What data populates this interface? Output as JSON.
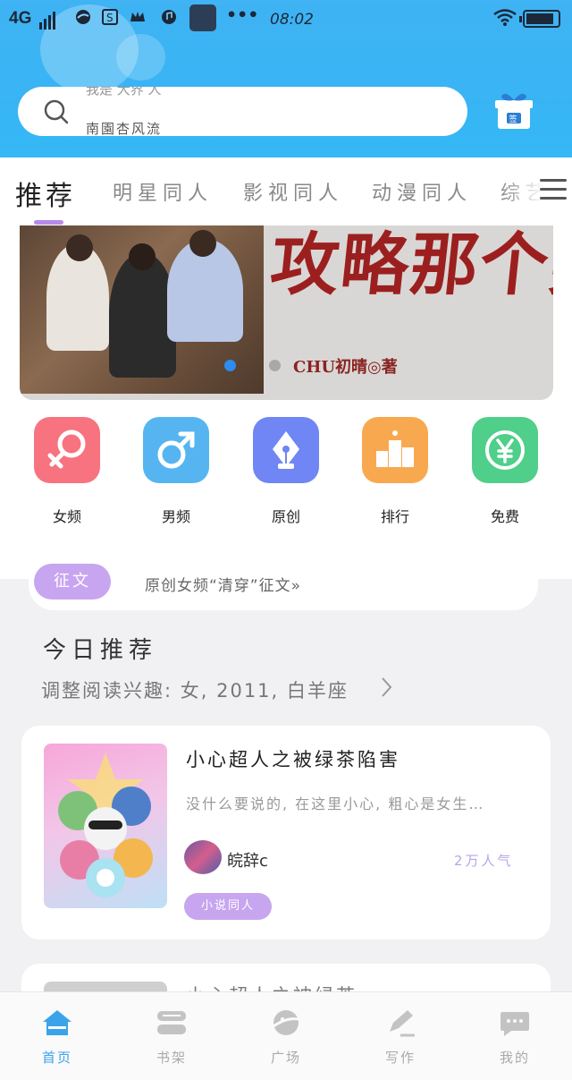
{
  "status_bar": {
    "network": "4G",
    "time": "08:02",
    "dots": "•••"
  },
  "search": {
    "placeholder_scroll_top": "我是 大界 人",
    "placeholder": "南園杏风流"
  },
  "tabs": [
    {
      "label": "推荐",
      "active": true
    },
    {
      "label": "明星同人",
      "active": false
    },
    {
      "label": "影视同人",
      "active": false
    },
    {
      "label": "动漫同人",
      "active": false
    },
    {
      "label": "综艺",
      "active": false
    }
  ],
  "banner": {
    "title": "攻略那个男人",
    "author": "CHU初晴◎著",
    "active_dot": 0
  },
  "categories": [
    {
      "label": "女频",
      "icon": "female-icon",
      "color": "#f6737f"
    },
    {
      "label": "男频",
      "icon": "male-icon",
      "color": "#56b5f0"
    },
    {
      "label": "原创",
      "icon": "pen-nib-icon",
      "color": "#6f86f4"
    },
    {
      "label": "排行",
      "icon": "ranking-icon",
      "color": "#f8a94f"
    },
    {
      "label": "免费",
      "icon": "yen-coin-icon",
      "color": "#4fcf8a"
    }
  ],
  "notice": {
    "tag": "征文",
    "text": "原创女频“清穿”征文»"
  },
  "today": {
    "title": "今日推荐",
    "subtitle": "调整阅读兴趣: 女, 2011, 白羊座"
  },
  "books": [
    {
      "title": "小心超人之被绿茶陷害",
      "description": "没什么要说的, 在这里小心, 粗心是女生…",
      "author": "皖辞c",
      "popularity": "2万人气",
      "tag": "小说同人"
    },
    {
      "title": "小心超人之被绿茶"
    }
  ],
  "bottom_nav": [
    {
      "label": "首页",
      "icon": "home-icon",
      "active": true
    },
    {
      "label": "书架",
      "icon": "bookshelf-icon",
      "active": false
    },
    {
      "label": "广场",
      "icon": "planet-icon",
      "active": false
    },
    {
      "label": "写作",
      "icon": "write-icon",
      "active": false
    },
    {
      "label": "我的",
      "icon": "profile-chat-icon",
      "active": false
    }
  ],
  "colors": {
    "header_blue": "#3fb3f3",
    "accent_purple": "#c8a5f0",
    "nav_active": "#3aa3ea"
  }
}
